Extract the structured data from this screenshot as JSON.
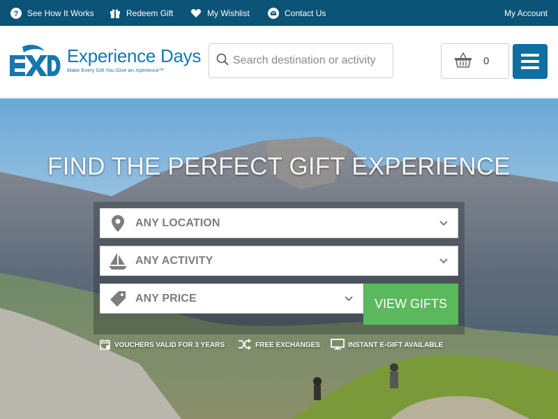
{
  "topbar": {
    "links": [
      {
        "label": "See How It Works",
        "icon": "question-circle-icon"
      },
      {
        "label": "Redeem Gift",
        "icon": "gift-icon"
      },
      {
        "label": "My Wishlist",
        "icon": "heart-icon"
      },
      {
        "label": "Contact Us",
        "icon": "envelope-icon"
      }
    ],
    "account_label": "My Account"
  },
  "header": {
    "logo_title": "Experience Days",
    "logo_tagline": "Make Every Gift You Give an Xperience™",
    "search_placeholder": "Search destination or activity",
    "cart_count": "0"
  },
  "hero": {
    "headline": "FIND THE PERFECT GIFT EXPERIENCE",
    "location_label": "ANY LOCATION",
    "activity_label": "ANY ACTIVITY",
    "price_label": "ANY PRICE",
    "button_label": "VIEW GIFTS",
    "perks": [
      {
        "label": "VOUCHERS VALID FOR 3 YEARS",
        "icon": "calendar-icon"
      },
      {
        "label": "FREE EXCHANGES",
        "icon": "shuffle-icon"
      },
      {
        "label": "INSTANT E-GIFT AVAILABLE",
        "icon": "monitor-icon"
      }
    ]
  },
  "colors": {
    "topbar_bg": "#0b5377",
    "brand_blue": "#1577b0",
    "menu_button": "#0e6fa0",
    "cta_green": "#5cb85c"
  }
}
